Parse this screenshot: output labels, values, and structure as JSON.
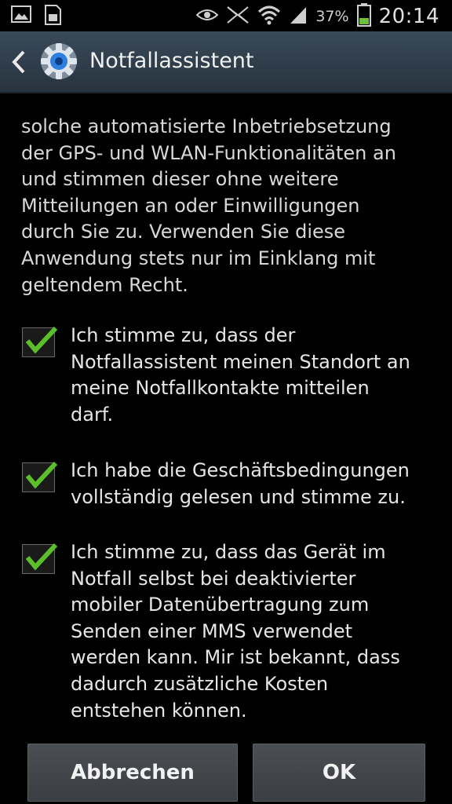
{
  "statusbar": {
    "battery_pct": "37%",
    "clock": "20:14",
    "icons": [
      "picture-icon",
      "sd-card-icon",
      "eye-icon",
      "nfc-icon",
      "wifi-icon",
      "signal-icon",
      "battery-icon"
    ]
  },
  "actionbar": {
    "title": "Notfallassistent",
    "icons": [
      "back-arrow-icon",
      "settings-gear-icon"
    ]
  },
  "content": {
    "paragraph": "solche automatisierte Inbetriebsetzung\nder GPS- und WLAN-Funktionalitäten an\nund stimmen dieser ohne weitere\nMitteilungen an oder Einwilligungen\ndurch Sie zu. Verwenden Sie diese\nAnwendung stets nur im Einklang mit\ngeltendem Recht.",
    "checkboxes": [
      {
        "label": "Ich stimme zu, dass der\nNotfallassistent meinen Standort an\nmeine Notfallkontakte mitteilen\ndarf.",
        "checked": true
      },
      {
        "label": "Ich habe die Geschäftsbedingungen\nvollständig gelesen und stimme zu.",
        "checked": true
      },
      {
        "label": "Ich stimme zu, dass das Gerät im\nNotfall selbst bei deaktivierter\nmobiler Datenübertragung zum\nSenden einer MMS verwendet\nwerden kann. Mir ist bekannt, dass\ndadurch zusätzliche Kosten\nentstehen können.",
        "checked": true
      }
    ]
  },
  "buttons": {
    "cancel": "Abbrechen",
    "ok": "OK"
  },
  "colors": {
    "check": "#5bbf2a",
    "actionbar": "#34414e"
  }
}
